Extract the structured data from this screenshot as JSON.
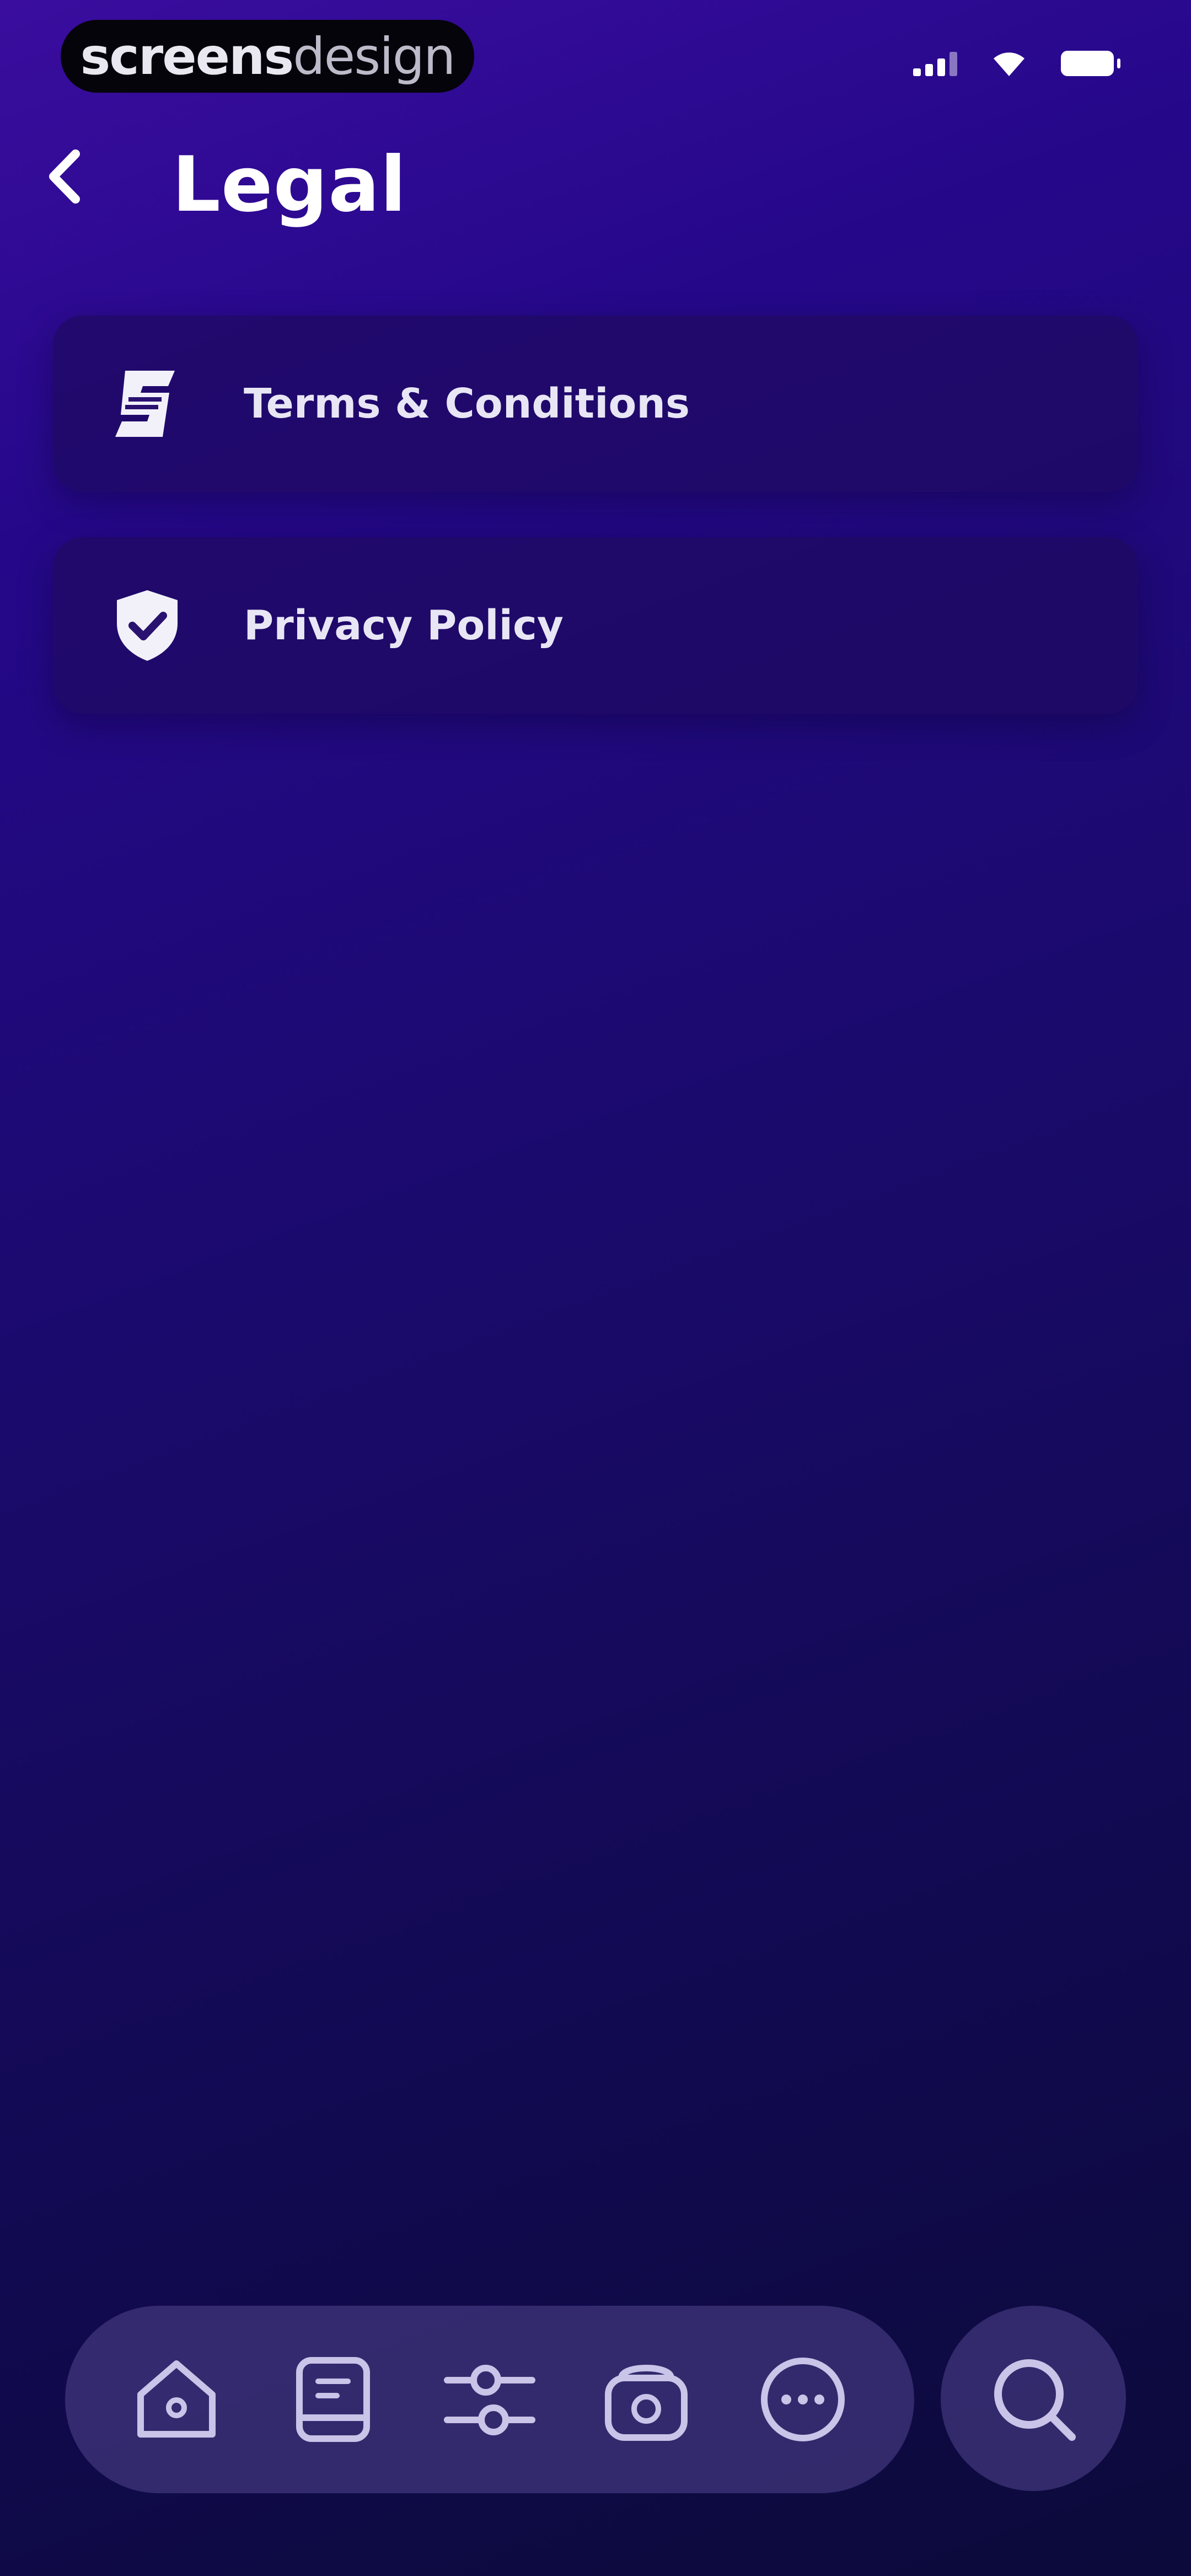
{
  "status_bar": {
    "brand_strong": "screens",
    "brand_light": "design",
    "icons": [
      "cellular-signal-icon",
      "wifi-icon",
      "battery-icon"
    ]
  },
  "header": {
    "back_icon": "chevron-left-icon",
    "title": "Legal"
  },
  "list": {
    "items": [
      {
        "icon": "terms-document-icon",
        "label": "Terms & Conditions"
      },
      {
        "icon": "shield-check-icon",
        "label": "Privacy Policy"
      }
    ]
  },
  "bottom_nav": {
    "items": [
      "home-icon",
      "book-icon",
      "sliders-icon",
      "radio-icon",
      "more-icon"
    ],
    "search_icon": "search-icon"
  },
  "colors": {
    "background_top": "#3a0d9e",
    "background_bottom": "#0b0a3a",
    "card": "#1e0a5f",
    "nav": "#463c82",
    "text": "#ffffff"
  }
}
